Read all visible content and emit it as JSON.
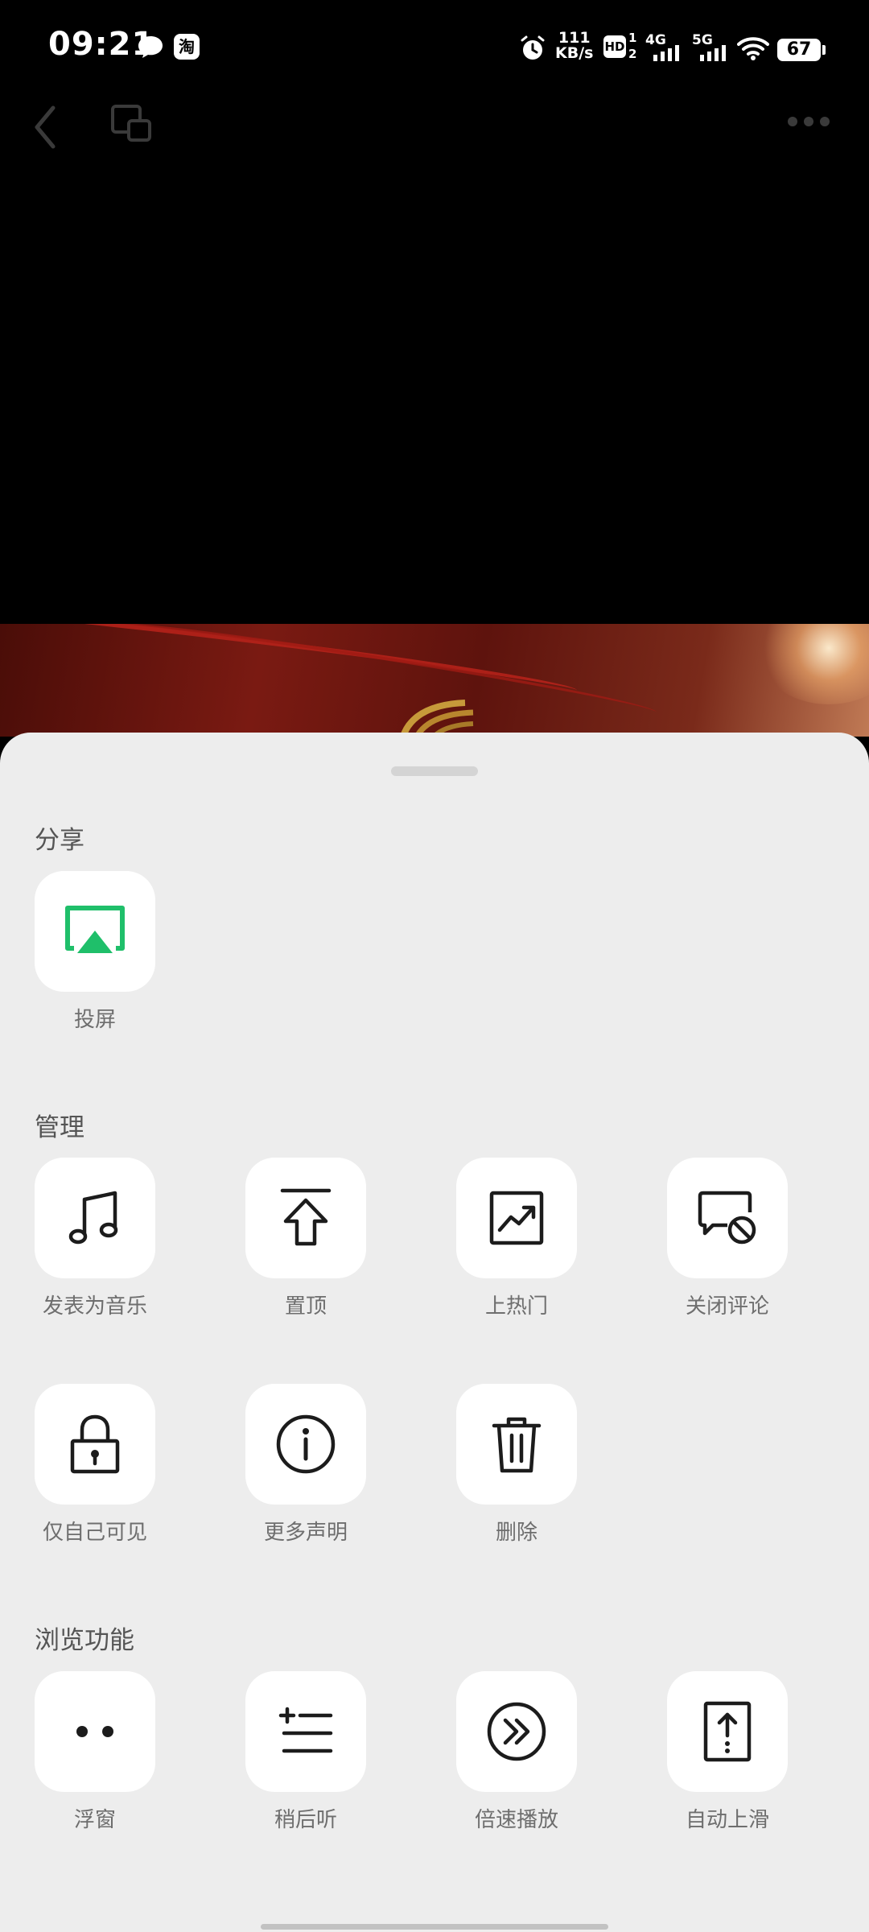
{
  "status_bar": {
    "time": "09:21",
    "taobao_badge": "淘",
    "net_speed_value": "111",
    "net_speed_unit": "KB/s",
    "hd_label": "HD",
    "sim_label_1": "1",
    "sim_label_2": "2",
    "network_1": "4G",
    "network_2": "5G",
    "battery": "67"
  },
  "sheet": {
    "sections": {
      "share": {
        "title": "分享",
        "items": [
          {
            "label": "投屏",
            "icon": "cast-icon"
          }
        ]
      },
      "manage": {
        "title": "管理",
        "items": [
          {
            "label": "发表为音乐",
            "icon": "music-note-icon"
          },
          {
            "label": "置顶",
            "icon": "pin-top-icon"
          },
          {
            "label": "上热门",
            "icon": "trending-icon"
          },
          {
            "label": "关闭评论",
            "icon": "comment-off-icon"
          },
          {
            "label": "仅自己可见",
            "icon": "lock-icon"
          },
          {
            "label": "更多声明",
            "icon": "info-icon"
          },
          {
            "label": "删除",
            "icon": "trash-icon"
          }
        ]
      },
      "browse": {
        "title": "浏览功能",
        "items": [
          {
            "label": "浮窗",
            "icon": "float-window-icon"
          },
          {
            "label": "稍后听",
            "icon": "listen-later-icon"
          },
          {
            "label": "倍速播放",
            "icon": "playback-speed-icon"
          },
          {
            "label": "自动上滑",
            "icon": "auto-scroll-icon"
          }
        ]
      }
    }
  },
  "colors": {
    "accent_green": "#1fbf6a",
    "sheet_bg": "#ededed",
    "video_red": "#7a1a12"
  }
}
